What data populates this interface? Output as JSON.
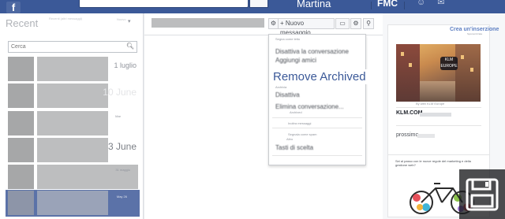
{
  "topbar": {
    "logo": "f",
    "user_name": "Martina",
    "nav_label": "FMC",
    "icons": [
      "friends-icon",
      "messages-icon",
      "notifications-icon"
    ],
    "icon_glyphs": "☺ ✉"
  },
  "left": {
    "title": "Recent",
    "subtitle": "Recenti (altri messaggi)",
    "new_label": "Nuovo",
    "search_placeholder": "Cerca",
    "threads": [
      {
        "date": "1 luglio",
        "tiny": ""
      },
      {
        "date": "10 June",
        "tiny": ""
      },
      {
        "date": "",
        "tiny": "Mar"
      },
      {
        "date": "3 June",
        "tiny": ""
      },
      {
        "date": "",
        "tiny": "31 maggio"
      },
      {
        "date": "",
        "tiny": "May 26"
      }
    ]
  },
  "conversation": {
    "new_message_label": "+ Nuovo messaggio",
    "header_buttons": [
      "video-icon",
      "gear-icon",
      "search-icon"
    ],
    "dropdown": {
      "items": [
        {
          "text": "Segna come letto",
          "kind": "small"
        },
        {
          "text": "Disattiva la conversazione",
          "kind": "large"
        },
        {
          "text": "Aggiungi amici",
          "kind": "large"
        },
        {
          "text": "Disattiva",
          "kind": "large"
        },
        {
          "text": "Elimina conversazione...",
          "kind": "large"
        },
        {
          "text": "Archivia",
          "kind": "small"
        },
        {
          "text": "Archived",
          "kind": "small"
        },
        {
          "text": "Inoltra messaggi",
          "kind": "small"
        },
        {
          "text": "Segnala come spam",
          "kind": "small"
        },
        {
          "text": "Altro",
          "kind": "small"
        },
        {
          "text": "Tasti di scelta",
          "kind": "large"
        }
      ],
      "overlay_label": "Remove Archived"
    }
  },
  "right": {
    "card1": {
      "title": "Crea un'inserzione",
      "subtitle": "Sponsorizzata",
      "image_badge": "KLM EUROPE",
      "caption": "By with KLM Europe",
      "brand": "KLM.COM",
      "next_label": "prossimo"
    },
    "card2": {
      "text": "Sei al passo con le nuove regole del marketing e della gestione web?"
    }
  },
  "colors": {
    "facebook_blue": "#3b5998",
    "selected_row": "#5b72a8",
    "link_blue": "#3b5998"
  }
}
